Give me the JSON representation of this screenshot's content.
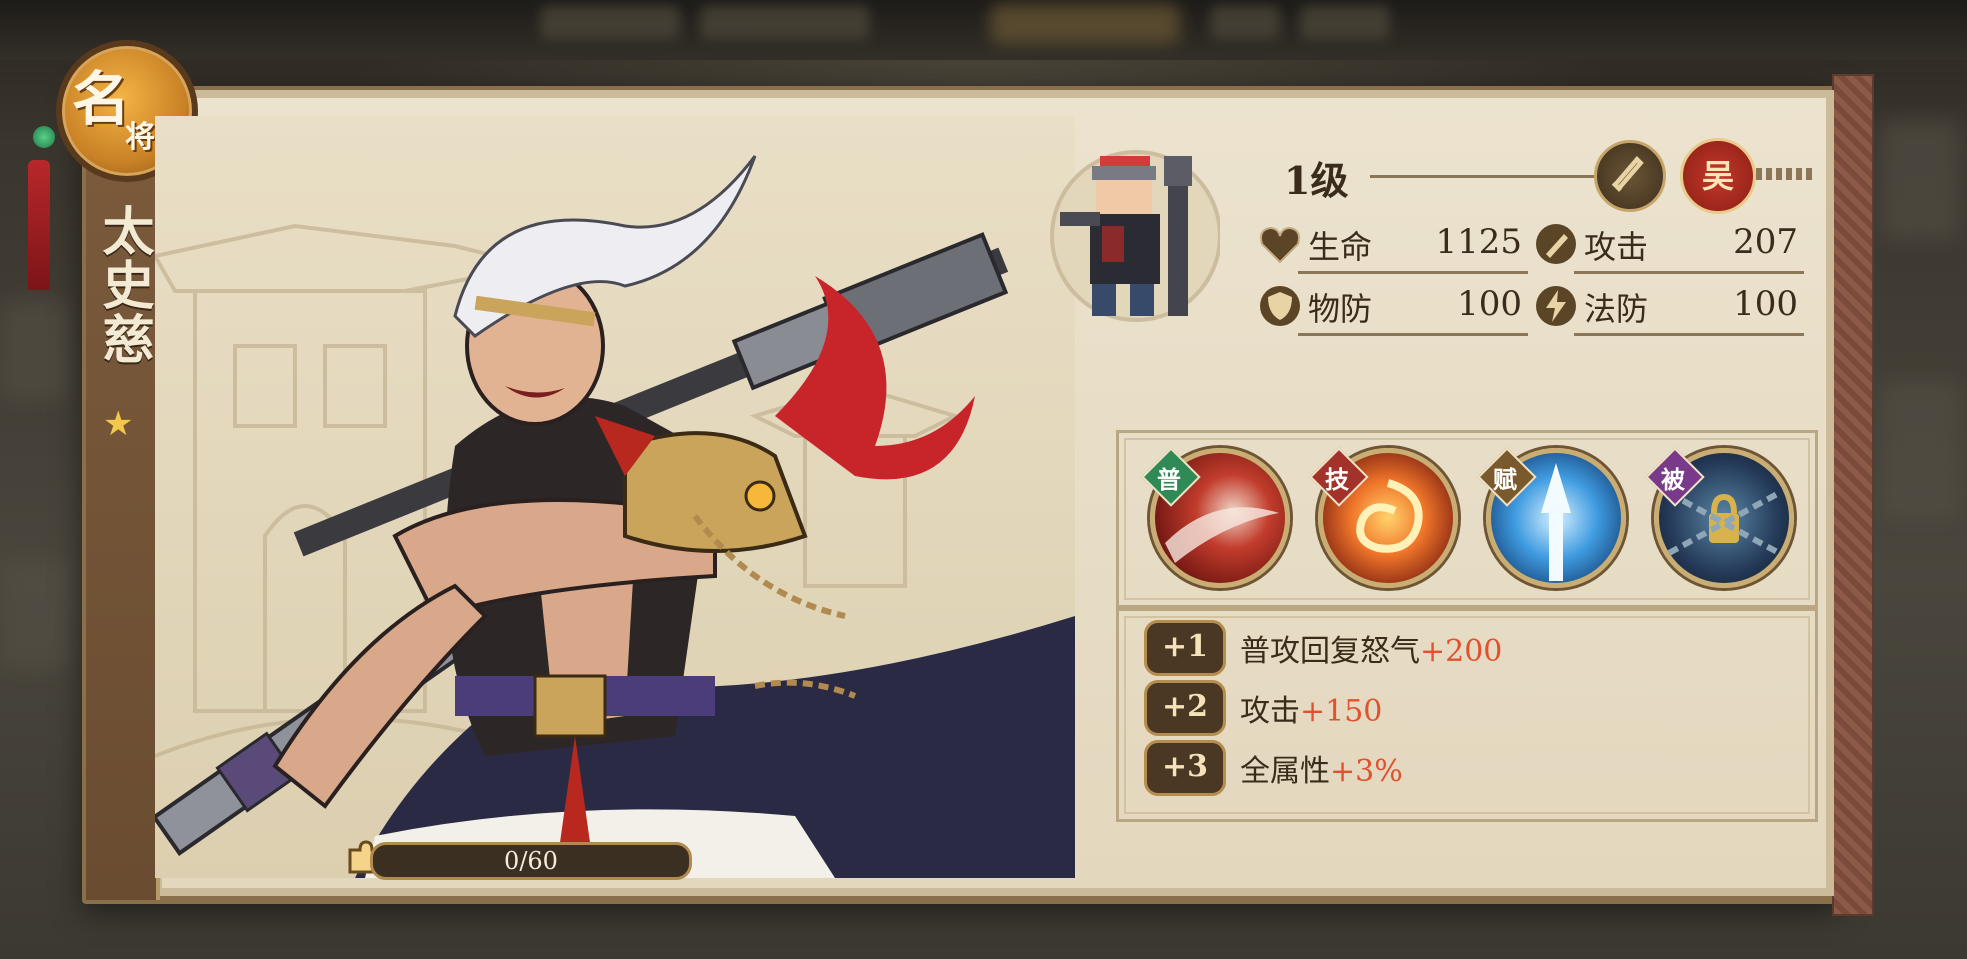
{
  "hero": {
    "badge_main": "名",
    "badge_sub": "将",
    "name": "太史慈",
    "star": "★",
    "level": "1级",
    "faction": "吴",
    "progress_text": "0/60",
    "progress_fraction": 0.0
  },
  "stats": [
    {
      "label": "生命",
      "value": "1125",
      "icon": "heart-icon"
    },
    {
      "label": "攻击",
      "value": "207",
      "icon": "sword-icon"
    },
    {
      "label": "物防",
      "value": "100",
      "icon": "shield-icon"
    },
    {
      "label": "法防",
      "value": "100",
      "icon": "lightning-icon"
    }
  ],
  "skills": [
    {
      "tag": "普",
      "tag_color": "#2f8a55",
      "icon": "red-slash-icon"
    },
    {
      "tag": "技",
      "tag_color": "#a3322b",
      "icon": "fire-swirl-icon"
    },
    {
      "tag": "赋",
      "tag_color": "#7a5a2c",
      "icon": "ice-spear-icon"
    },
    {
      "tag": "被",
      "tag_color": "#7a3a8a",
      "icon": "chain-lock-icon"
    }
  ],
  "bonuses": [
    {
      "pill": "+1",
      "text": "普攻回复怒气",
      "value": "+200"
    },
    {
      "pill": "+2",
      "text": "攻击",
      "value": "+150"
    },
    {
      "pill": "+3",
      "text": "全属性",
      "value": "+3%"
    }
  ]
}
